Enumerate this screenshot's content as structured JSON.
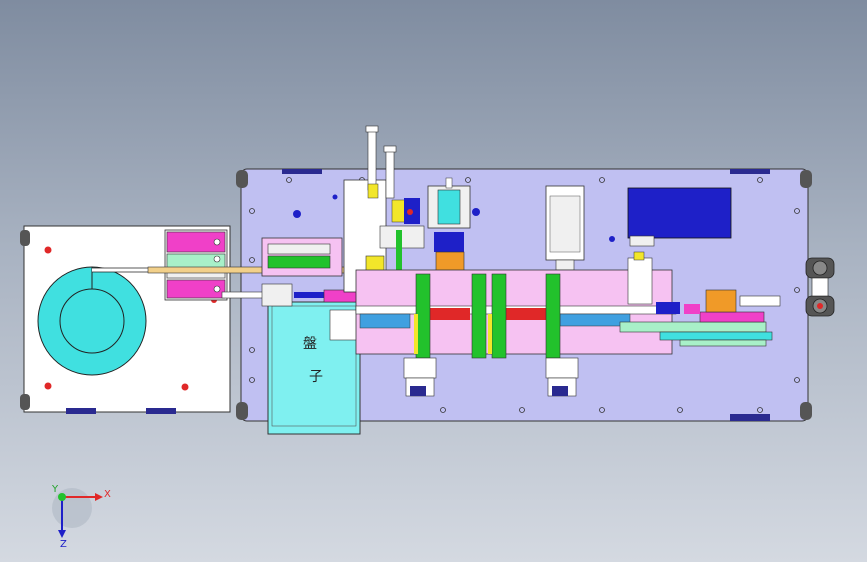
{
  "drawing": {
    "tray_label_line1": "盤",
    "tray_label_line2": "子"
  },
  "triad": {
    "x_label": "X",
    "y_label": "Y",
    "z_label": "Z"
  },
  "colors": {
    "base_plate": "#c0c0f2",
    "feeder_plate": "#ffffff",
    "reel": "#40e0e0",
    "tray": "#7ff0f0",
    "slide_track": "#f6c2f2",
    "green_block": "#22c22c",
    "red_rail": "#e02828",
    "blue_motor": "#1e20c8",
    "magenta_block": "#f040c8",
    "orange_block": "#f09a28",
    "yellow_block": "#f2e62a"
  }
}
